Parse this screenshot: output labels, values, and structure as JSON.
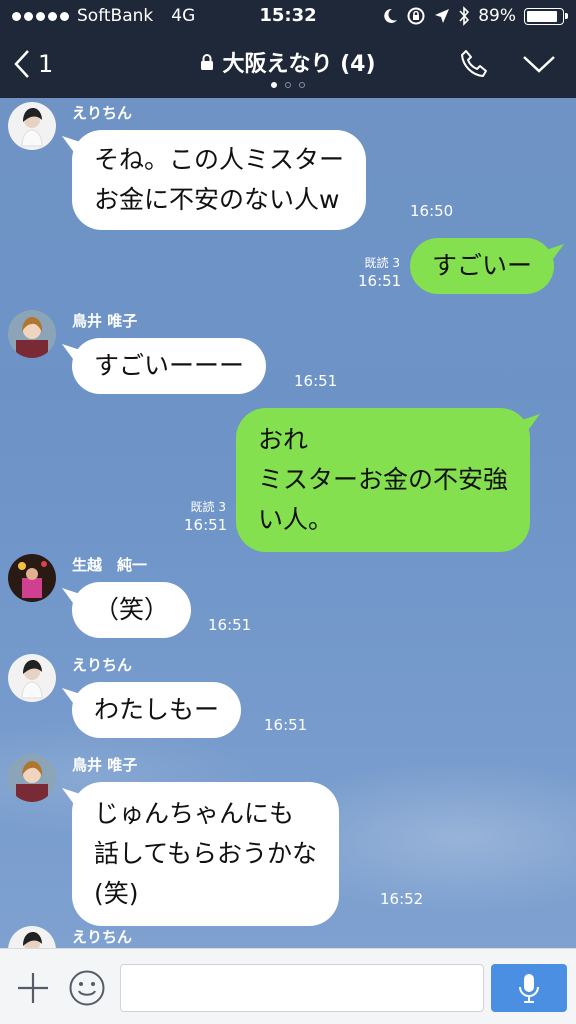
{
  "status_bar": {
    "carrier": "SoftBank",
    "network": "4G",
    "time": "15:32",
    "battery": "89%",
    "battery_level": 0.89
  },
  "header": {
    "back_count": "1",
    "title": "大阪えなり (4)",
    "page_count": 3,
    "page_active": 0
  },
  "messages": [
    {
      "type": "in",
      "sender": "えりちん",
      "lines": [
        "そね。この人ミスター",
        "お金に不安のない人w"
      ],
      "time": "16:50"
    },
    {
      "type": "out",
      "read": "既読 3",
      "lines": [
        "すごいー"
      ],
      "time": "16:51"
    },
    {
      "type": "in",
      "sender": "鳥井 唯子",
      "lines": [
        "すごいーーー"
      ],
      "time": "16:51"
    },
    {
      "type": "out",
      "read": "既読 3",
      "lines": [
        "おれ",
        "ミスターお金の不安強",
        "い人。"
      ],
      "time": "16:51"
    },
    {
      "type": "in",
      "sender": "生越　純一",
      "lines": [
        "（笑）"
      ],
      "time": "16:51"
    },
    {
      "type": "in",
      "sender": "えりちん",
      "lines": [
        "わたしもー"
      ],
      "time": "16:51"
    },
    {
      "type": "in",
      "sender": "鳥井 唯子",
      "lines": [
        "じゅんちゃんにも",
        "話してもらおうかな",
        "(笑)"
      ],
      "time": "16:52"
    },
    {
      "type": "in",
      "sender": "えりちん",
      "lines": [],
      "time": ""
    }
  ],
  "input": {
    "placeholder": ""
  },
  "colors": {
    "header_bg": "#1f2838",
    "chat_bg": "#6f93c4",
    "outgoing": "#84e04f",
    "incoming": "#ffffff",
    "mic": "#4a8fe2"
  },
  "icons": [
    "back-chevron-icon",
    "lock-icon",
    "phone-icon",
    "chevron-down-icon",
    "plus-icon",
    "emoji-icon",
    "mic-icon",
    "location-icon",
    "bluetooth-icon",
    "moon-icon",
    "rotation-lock-icon"
  ]
}
